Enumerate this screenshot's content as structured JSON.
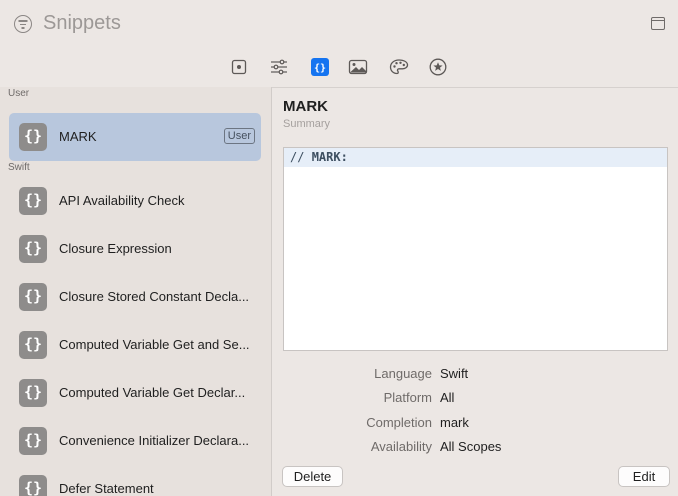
{
  "window": {
    "title": "Snippets"
  },
  "toolbar": {
    "tabs": [
      {
        "icon": "file-icon",
        "selected": false
      },
      {
        "icon": "sliders-icon",
        "selected": false
      },
      {
        "icon": "code-braces-icon",
        "selected": true
      },
      {
        "icon": "image-icon",
        "selected": false
      },
      {
        "icon": "palette-icon",
        "selected": false
      },
      {
        "icon": "star-circle-icon",
        "selected": false
      }
    ],
    "accent": "#1574f0"
  },
  "sidebar": {
    "sections": [
      {
        "header": "User",
        "items": [
          {
            "title": "MARK",
            "badge": "User",
            "selected": true,
            "icon": "{}"
          }
        ]
      },
      {
        "header": "Swift",
        "items": [
          {
            "title": "API Availability Check",
            "icon": "{}"
          },
          {
            "title": "Closure Expression",
            "icon": "{}"
          },
          {
            "title": "Closure Stored Constant Decla...",
            "icon": "{}"
          },
          {
            "title": "Computed Variable Get and Se...",
            "icon": "{}"
          },
          {
            "title": "Computed Variable Get Declar...",
            "icon": "{}"
          },
          {
            "title": "Convenience Initializer Declara...",
            "icon": "{}"
          },
          {
            "title": "Defer Statement",
            "icon": "{}"
          }
        ]
      }
    ]
  },
  "detail": {
    "title": "MARK",
    "summary": "Summary",
    "code_comment": "// ",
    "code_keyword": "MARK:",
    "meta": [
      {
        "label": "Language",
        "value": "Swift"
      },
      {
        "label": "Platform",
        "value": "All"
      },
      {
        "label": "Completion",
        "value": "mark"
      },
      {
        "label": "Availability",
        "value": "All Scopes"
      }
    ],
    "delete_label": "Delete",
    "edit_label": "Edit"
  }
}
